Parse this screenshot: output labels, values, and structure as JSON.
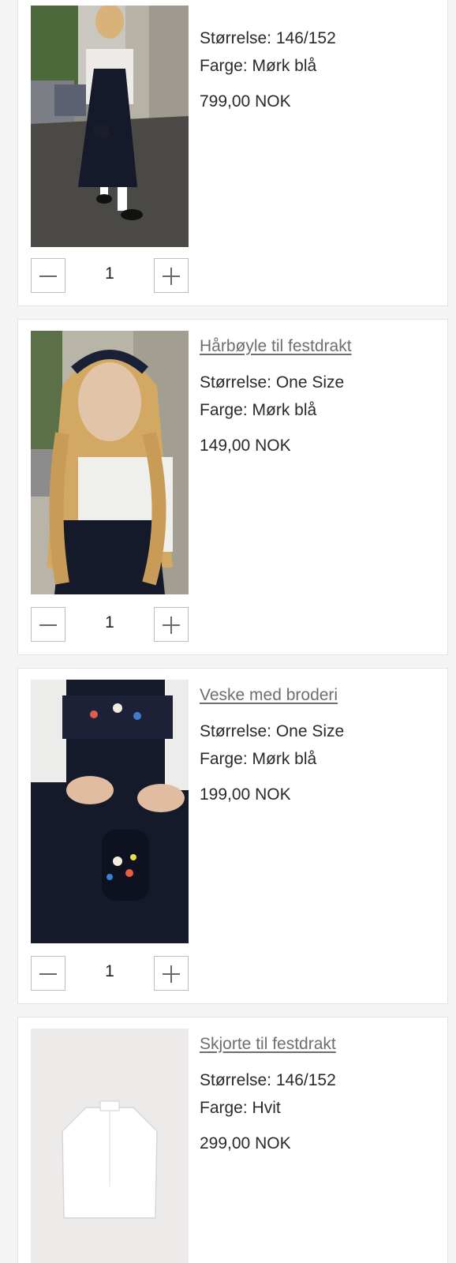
{
  "cart": {
    "items": [
      {
        "name": "",
        "size_label": "Størrelse: 146/152",
        "color_label": "Farge: Mørk blå",
        "price": "799,00 NOK",
        "quantity": "1",
        "image": "girl-in-dark-blue-dress-on-street-photo"
      },
      {
        "name": "Hårbøyle til festdrakt",
        "size_label": "Størrelse: One Size",
        "color_label": "Farge: Mørk blå",
        "price": "149,00 NOK",
        "quantity": "1",
        "image": "girl-with-blue-headband-photo"
      },
      {
        "name": "Veske med broderi",
        "size_label": "Størrelse: One Size",
        "color_label": "Farge: Mørk blå",
        "price": "199,00 NOK",
        "quantity": "1",
        "image": "embroidered-bag-photo"
      },
      {
        "name": "Skjorte til festdrakt",
        "size_label": "Størrelse: 146/152",
        "color_label": "Farge: Hvit",
        "price": "299,00 NOK",
        "quantity": "1",
        "image": "white-shirt-photo"
      }
    ]
  },
  "colors": {
    "card_bg": "#ffffff",
    "page_bg": "#f4f4f4",
    "link_text": "#6e6e6e",
    "dress_navy": "#161a2a"
  }
}
